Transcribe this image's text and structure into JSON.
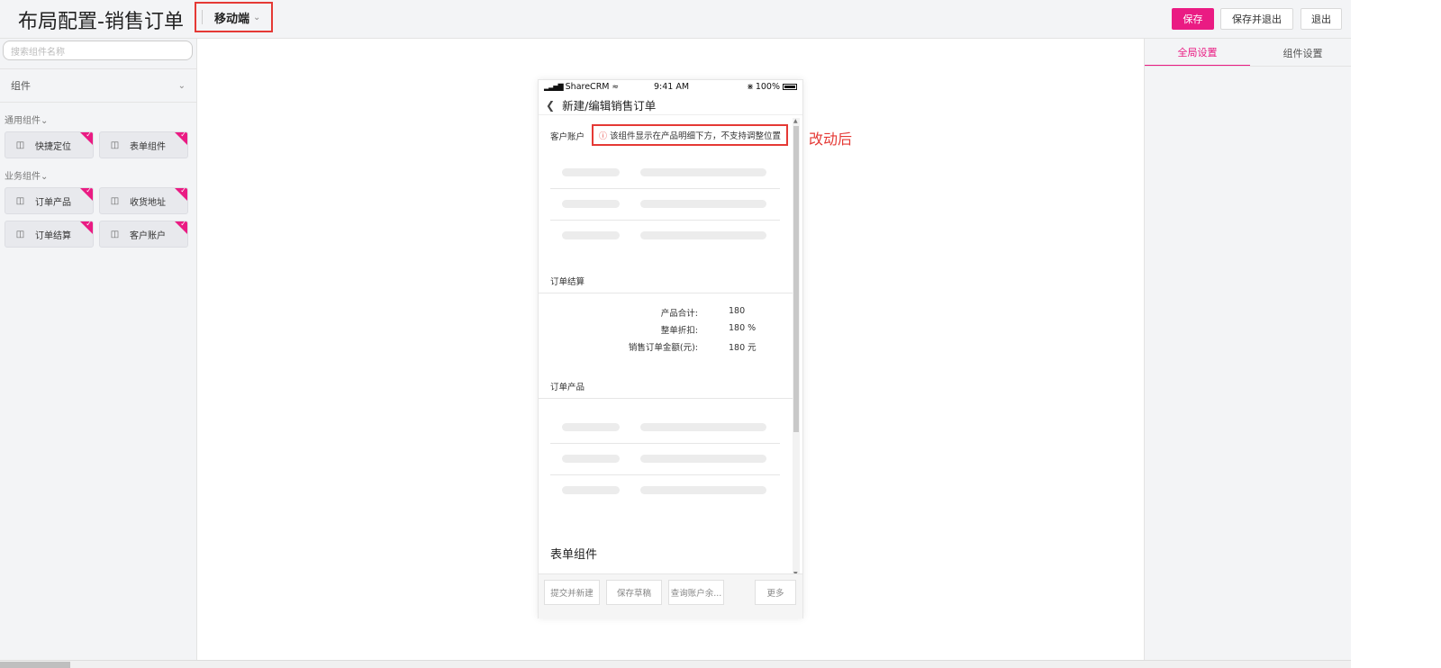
{
  "header": {
    "title": "布局配置-销售订单",
    "mode_label": "移动端",
    "save_label": "保存",
    "save_exit_label": "保存并退出",
    "exit_label": "退出"
  },
  "left_panel": {
    "search_placeholder": "搜索组件名称",
    "components_heading": "组件",
    "groups": [
      {
        "label": "通用组件",
        "items": [
          "快捷定位",
          "表单组件"
        ]
      },
      {
        "label": "业务组件",
        "items": [
          "订单产品",
          "收货地址",
          "订单结算",
          "客户账户"
        ]
      }
    ]
  },
  "right_panel": {
    "tabs": [
      "全局设置",
      "组件设置"
    ],
    "active_tab": "全局设置"
  },
  "phone": {
    "carrier": "ShareCRM",
    "time": "9:41 AM",
    "battery": "100%",
    "nav_title": "新建/编辑销售订单",
    "account_label": "客户账户",
    "notice": "该组件显示在产品明细下方，不支持调整位置",
    "settlement_title": "订单结算",
    "summary": [
      {
        "key": "产品合计:",
        "value": "180"
      },
      {
        "key": "整单折扣:",
        "value": "180 %"
      },
      {
        "key": "销售订单金额(元):",
        "value": "180 元"
      }
    ],
    "products_title": "订单产品",
    "form_title": "表单组件",
    "buttons": [
      "提交并新建",
      "保存草稿",
      "查询账户余...",
      "更多"
    ]
  },
  "annotation": "改动后",
  "colors": {
    "accent": "#ea1b83",
    "highlight": "#e53935"
  }
}
